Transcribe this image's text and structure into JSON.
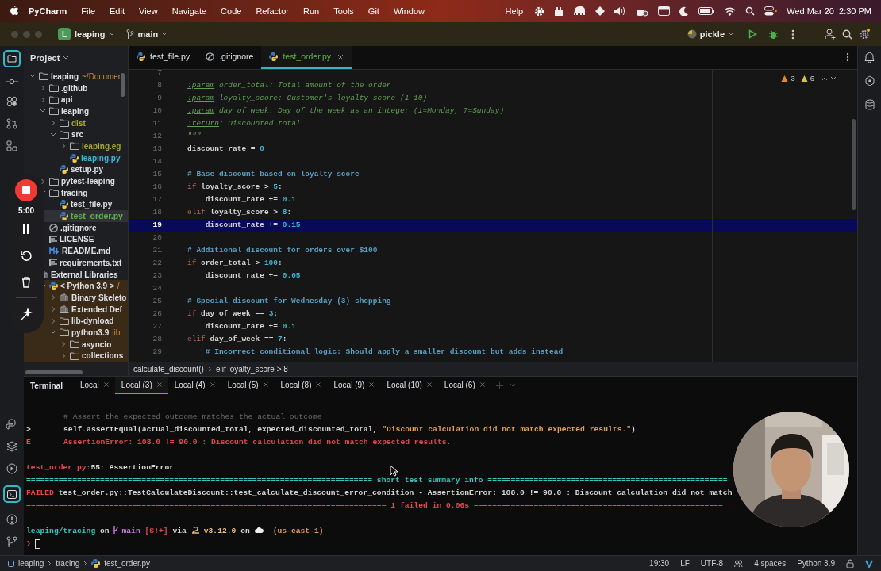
{
  "menu_bar": {
    "menus": [
      {
        "label": "PyCharm",
        "kind": "app"
      },
      {
        "label": "File",
        "kind": "menu"
      },
      {
        "label": "Edit",
        "kind": "menu"
      },
      {
        "label": "View",
        "kind": "menu"
      },
      {
        "label": "Navigate",
        "kind": "menu"
      },
      {
        "label": "Code",
        "kind": "menu"
      },
      {
        "label": "Refactor",
        "kind": "menu"
      },
      {
        "label": "Run",
        "kind": "menu"
      },
      {
        "label": "Tools",
        "kind": "menu"
      },
      {
        "label": "Git",
        "kind": "menu"
      },
      {
        "label": "Window",
        "kind": "menu"
      }
    ],
    "help": "Help",
    "clock": "Wed Mar 20  2:30 PM"
  },
  "toolbar": {
    "project_badge": "L",
    "project": "leaping",
    "branch": "main",
    "run_config": "pickle"
  },
  "project_panel": {
    "title": "Project",
    "tree": [
      {
        "label": "leaping",
        "kind": "folder",
        "hint": "~/Documen",
        "expanded": true,
        "selected": false,
        "color": "#dfe1e5",
        "children": [
          {
            "label": ".github",
            "kind": "folder",
            "expanded": false,
            "selected": false,
            "color": "#dfe1e5"
          },
          {
            "label": "api",
            "kind": "folder",
            "expanded": false,
            "selected": false,
            "color": "#dfe1e5"
          },
          {
            "label": "leaping",
            "kind": "folder",
            "expanded": true,
            "selected": false,
            "color": "#dfe1e5",
            "children": [
              {
                "label": "dist",
                "kind": "folder",
                "expanded": false,
                "selected": false,
                "color": "#a8a53a"
              },
              {
                "label": "src",
                "kind": "folder",
                "expanded": true,
                "selected": false,
                "color": "#dfe1e5",
                "children": [
                  {
                    "label": "leaping.eg",
                    "kind": "folder",
                    "expanded": false,
                    "selected": false,
                    "color": "#a8a53a"
                  },
                  {
                    "label": "leaping.py",
                    "kind": "python",
                    "selected": false,
                    "color": "#3fb4d6"
                  }
                ]
              },
              {
                "label": "setup.py",
                "kind": "python",
                "selected": false,
                "color": "#dfe1e5"
              }
            ]
          },
          {
            "label": "pytest-leaping",
            "kind": "folder",
            "expanded": false,
            "selected": false,
            "color": "#dfe1e5"
          },
          {
            "label": "tracing",
            "kind": "folder",
            "expanded": true,
            "selected": false,
            "color": "#dfe1e5",
            "children": [
              {
                "label": "test_file.py",
                "kind": "python",
                "selected": false,
                "color": "#dfe1e5"
              },
              {
                "label": "test_order.py",
                "kind": "python",
                "selected": true,
                "color": "#5fb346"
              }
            ]
          },
          {
            "label": ".gitignore",
            "kind": "ignore",
            "selected": false,
            "color": "#dfe1e5"
          },
          {
            "label": "LICENSE",
            "kind": "text",
            "selected": false,
            "color": "#dfe1e5"
          },
          {
            "label": "README.md",
            "kind": "markdown",
            "selected": false,
            "color": "#dfe1e5"
          },
          {
            "label": "requirements.txt",
            "kind": "text",
            "selected": false,
            "color": "#dfe1e5"
          }
        ]
      },
      {
        "label": "External Libraries",
        "kind": "library",
        "expanded": true,
        "selected": false,
        "color": "#dfe1e5",
        "children": [
          {
            "label": "< Python 3.9 >",
            "kind": "python",
            "hint": "/",
            "expanded": true,
            "selected": false,
            "color": "#dfe1e5",
            "children": [
              {
                "label": "Binary Skeleto",
                "kind": "library",
                "expanded": false,
                "selected": false,
                "color": "#dfe1e5"
              },
              {
                "label": "Extended Def",
                "kind": "library",
                "expanded": false,
                "selected": false,
                "color": "#dfe1e5"
              },
              {
                "label": "lib-dynload",
                "kind": "folder",
                "expanded": false,
                "selected": false,
                "color": "#dfe1e5"
              },
              {
                "label": "python3.9",
                "kind": "folder",
                "hint": "lib",
                "expanded": true,
                "selected": false,
                "color": "#dfe1e5",
                "children": [
                  {
                    "label": "asyncio",
                    "kind": "folder",
                    "expanded": false,
                    "selected": false,
                    "color": "#dfe1e5"
                  },
                  {
                    "label": "collections",
                    "kind": "folder",
                    "expanded": false,
                    "selected": false,
                    "color": "#dfe1e5"
                  }
                ]
              }
            ]
          }
        ]
      }
    ]
  },
  "recorder": {
    "timer": "5:00"
  },
  "editor": {
    "tabs": [
      {
        "label": "test_file.py",
        "kind": "python",
        "selected": false
      },
      {
        "label": ".gitignore",
        "kind": "ignore",
        "selected": false
      },
      {
        "label": "test_order.py",
        "kind": "python",
        "selected": true
      }
    ],
    "inspections": {
      "errors": "3",
      "warnings": "6"
    },
    "lines": [
      {
        "number": "7",
        "current": false
      },
      {
        "number": "8",
        "current": false,
        "segments": [
          {
            "kind": "doctag",
            "text": ":param"
          },
          {
            "kind": "doc",
            "text": " order_total: Total amount of the order"
          }
        ]
      },
      {
        "number": "9",
        "current": false,
        "segments": [
          {
            "kind": "doctag",
            "text": ":param"
          },
          {
            "kind": "doc",
            "text": " loyalty_score: Customer's loyalty score (1-10)"
          }
        ]
      },
      {
        "number": "10",
        "current": false,
        "segments": [
          {
            "kind": "doctag",
            "text": ":param"
          },
          {
            "kind": "doc",
            "text": " day_of_week: Day of the week as an integer (1=Monday, 7=Sunday)"
          }
        ]
      },
      {
        "number": "11",
        "current": false,
        "segments": [
          {
            "kind": "doctag",
            "text": ":return"
          },
          {
            "kind": "doc",
            "text": ": Discounted total"
          }
        ]
      },
      {
        "number": "12",
        "current": false,
        "segments": [
          {
            "kind": "doc",
            "text": "\"\"\""
          }
        ]
      },
      {
        "number": "13",
        "current": false,
        "segments": [
          {
            "kind": "plain",
            "text": "discount_rate = "
          },
          {
            "kind": "num",
            "text": "0"
          }
        ]
      },
      {
        "number": "14",
        "current": false
      },
      {
        "number": "15",
        "current": false,
        "segments": [
          {
            "kind": "comment",
            "text": "# Base discount based on loyalty score"
          }
        ]
      },
      {
        "number": "16",
        "current": false,
        "segments": [
          {
            "kind": "kw",
            "text": "if"
          },
          {
            "kind": "plain",
            "text": " loyalty_score > "
          },
          {
            "kind": "num",
            "text": "5"
          },
          {
            "kind": "plain",
            "text": ":"
          }
        ]
      },
      {
        "number": "17",
        "current": false,
        "segments": [
          {
            "kind": "plain",
            "text": "    discount_rate += "
          },
          {
            "kind": "num",
            "text": "0.1"
          }
        ]
      },
      {
        "number": "18",
        "current": false,
        "segments": [
          {
            "kind": "kw",
            "text": "elif"
          },
          {
            "kind": "plain",
            "text": " loyalty_score > "
          },
          {
            "kind": "num",
            "text": "8"
          },
          {
            "kind": "plain",
            "text": ":"
          }
        ]
      },
      {
        "number": "19",
        "current": true,
        "segments": [
          {
            "kind": "plain",
            "text": "    discount_rate += "
          },
          {
            "kind": "num",
            "text": "0.15"
          }
        ]
      },
      {
        "number": "20",
        "current": false
      },
      {
        "number": "21",
        "current": false,
        "segments": [
          {
            "kind": "comment",
            "text": "# Additional discount for orders over $100"
          }
        ]
      },
      {
        "number": "22",
        "current": false,
        "segments": [
          {
            "kind": "kw",
            "text": "if"
          },
          {
            "kind": "plain",
            "text": " order_total > "
          },
          {
            "kind": "num",
            "text": "100"
          },
          {
            "kind": "plain",
            "text": ":"
          }
        ]
      },
      {
        "number": "23",
        "current": false,
        "segments": [
          {
            "kind": "plain",
            "text": "    discount_rate += "
          },
          {
            "kind": "num",
            "text": "0.05"
          }
        ]
      },
      {
        "number": "24",
        "current": false
      },
      {
        "number": "25",
        "current": false,
        "segments": [
          {
            "kind": "comment",
            "text": "# Special discount for Wednesday (3) shopping"
          }
        ]
      },
      {
        "number": "26",
        "current": false,
        "segments": [
          {
            "kind": "kw",
            "text": "if"
          },
          {
            "kind": "plain",
            "text": " day_of_week == "
          },
          {
            "kind": "num",
            "text": "3"
          },
          {
            "kind": "plain",
            "text": ":"
          }
        ]
      },
      {
        "number": "27",
        "current": false,
        "segments": [
          {
            "kind": "plain",
            "text": "    discount_rate += "
          },
          {
            "kind": "num",
            "text": "0.1"
          }
        ]
      },
      {
        "number": "28",
        "current": false,
        "segments": [
          {
            "kind": "kw",
            "text": "elif"
          },
          {
            "kind": "plain",
            "text": " day_of_week == "
          },
          {
            "kind": "num",
            "text": "7"
          },
          {
            "kind": "plain",
            "text": ":"
          }
        ]
      },
      {
        "number": "29",
        "current": false,
        "segments": [
          {
            "kind": "comment",
            "text": "    # Incorrect conditional logic: Should apply a smaller discount but adds instead"
          }
        ]
      }
    ],
    "breadcrumbs": [
      "calculate_discount()",
      "elif loyalty_score > 8"
    ]
  },
  "terminal": {
    "title": "Terminal",
    "tabs": [
      {
        "label": "Local",
        "selected": false
      },
      {
        "label": "Local (3)",
        "selected": true
      },
      {
        "label": "Local (4)",
        "selected": false
      },
      {
        "label": "Local (5)",
        "selected": false
      },
      {
        "label": "Local (8)",
        "selected": false
      },
      {
        "label": "Local (9)",
        "selected": false
      },
      {
        "label": "Local (10)",
        "selected": false
      },
      {
        "label": "Local (6)",
        "selected": false
      }
    ],
    "lines": [
      {
        "kind": "traceback",
        "segments": [
          {
            "kind": "comment",
            "text": "# Assert the expected outcome matches the actual outcome"
          }
        ]
      },
      {
        "kind": "traceback",
        "marker": {
          "kind": "plain",
          "text": ">"
        },
        "segments": [
          {
            "kind": "code",
            "text": "self.assertEqual(actual_discounted_total, expected_discounted_total, "
          },
          {
            "kind": "string",
            "text": "\"Discount calculation did not match expected results.\""
          },
          {
            "kind": "code",
            "text": ")"
          }
        ]
      },
      {
        "kind": "traceback",
        "marker": {
          "kind": "error",
          "text": "E"
        },
        "segments": [
          {
            "kind": "error",
            "text": "AssertionError: 108.0 != 90.0 : Discount calculation did not match expected results."
          }
        ]
      },
      {
        "kind": "blank"
      },
      {
        "kind": "output",
        "segments": [
          {
            "kind": "error",
            "text": "test_order.py"
          },
          {
            "kind": "plain",
            "text": ":55: AssertionError"
          }
        ]
      },
      {
        "kind": "output",
        "segments": [
          {
            "kind": "info",
            "text": "=========================================================================== short test summary info ===================================================="
          }
        ]
      },
      {
        "kind": "output",
        "segments": [
          {
            "kind": "error",
            "text": "FAILED"
          },
          {
            "kind": "plain",
            "text": " test_order.py::TestCalculateDiscount::test_calculate_discount_error_condition - AssertionError: 108.0 != 90.0 : Discount calculation did not match"
          }
        ]
      },
      {
        "kind": "output",
        "segments": [
          {
            "kind": "error",
            "text": "============================================================================== 1 failed in 0.06s ======================================================"
          }
        ]
      },
      {
        "kind": "blank"
      },
      {
        "kind": "output",
        "segments": [
          {
            "kind": "path",
            "text": "leaping/tracing"
          },
          {
            "kind": "plain",
            "text": " on "
          },
          {
            "kind": "branch",
            "text": "main"
          },
          {
            "kind": "status",
            "text": " [$!+]"
          },
          {
            "kind": "plain",
            "text": " via "
          },
          {
            "kind": "version",
            "text": "v3.12.0"
          },
          {
            "kind": "plain",
            "text": " on "
          },
          {
            "kind": "region",
            "text": "(us-east-1)"
          }
        ]
      },
      {
        "kind": "input",
        "segments": [
          {
            "kind": "error",
            "text": "❯"
          }
        ]
      }
    ]
  },
  "status_bar": {
    "path": [
      "leaping",
      "tracing",
      "test_order.py"
    ],
    "items": [
      "19:30",
      "LF",
      "UTF-8",
      "4 spaces",
      "Python 3.9"
    ]
  }
}
